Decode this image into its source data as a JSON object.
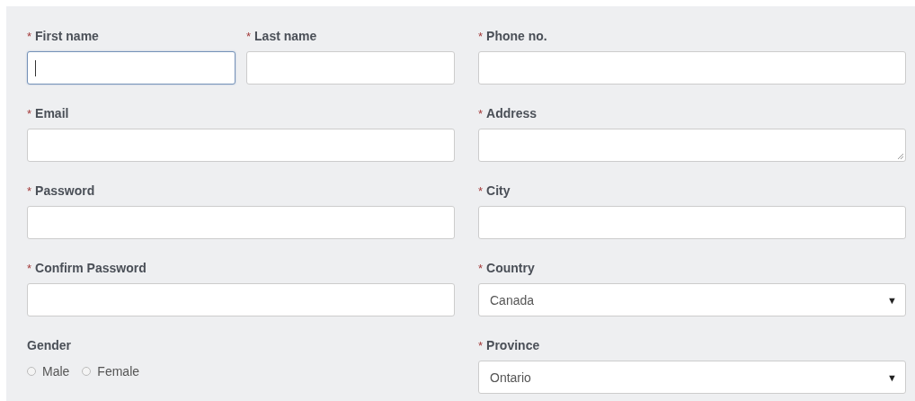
{
  "rows": [
    {
      "left": [
        {
          "kind": "text",
          "mark": "*",
          "label": "First name",
          "focused": true
        },
        {
          "kind": "text",
          "mark": "*",
          "label": "Last name",
          "focused": false
        }
      ],
      "right": [
        {
          "kind": "text",
          "mark": "*",
          "label": "Phone no.",
          "focused": false
        }
      ]
    },
    {
      "left": [
        {
          "kind": "text",
          "mark": "*",
          "label": "Email",
          "focused": false
        }
      ],
      "right": [
        {
          "kind": "textarea",
          "mark": "*",
          "label": "Address",
          "focused": false
        }
      ]
    },
    {
      "left": [
        {
          "kind": "text",
          "mark": "*",
          "label": "Password",
          "focused": false
        }
      ],
      "right": [
        {
          "kind": "text",
          "mark": "*",
          "label": "City",
          "focused": false
        }
      ]
    },
    {
      "left": [
        {
          "kind": "text",
          "mark": "*",
          "label": "Confirm Password",
          "focused": false
        }
      ],
      "right": [
        {
          "kind": "select",
          "mark": "*",
          "label": "Country",
          "value": "Canada",
          "arrow": "▼"
        }
      ]
    },
    {
      "left": [
        {
          "kind": "radio",
          "label": "Gender",
          "options": [
            {
              "label": "Male",
              "checked": false
            },
            {
              "label": "Female",
              "checked": false
            }
          ]
        }
      ],
      "right": [
        {
          "kind": "select",
          "mark": "*",
          "label": "Province",
          "value": "Ontario",
          "arrow": "▼"
        }
      ]
    }
  ]
}
